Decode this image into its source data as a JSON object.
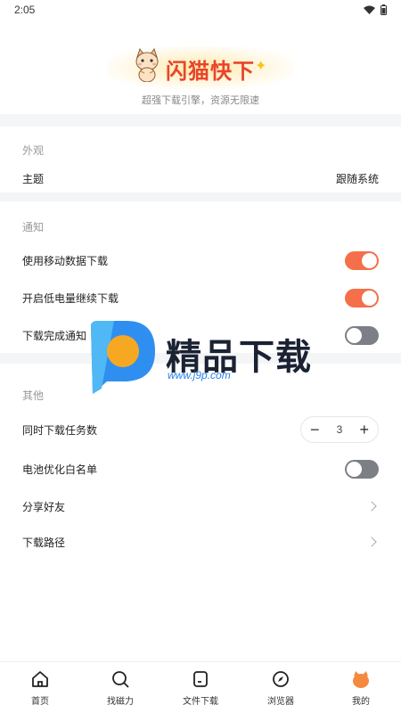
{
  "status_bar": {
    "time": "2:05",
    "icons": [
      "wifi-icon",
      "battery-icon"
    ]
  },
  "header": {
    "app_name": "闪猫快下",
    "tagline": "超强下载引擎，资源无限速"
  },
  "sections": {
    "appearance": {
      "title": "外观",
      "theme": {
        "label": "主题",
        "value": "跟随系统"
      }
    },
    "notifications": {
      "title": "通知",
      "mobile_data": {
        "label": "使用移动数据下载",
        "enabled": true
      },
      "low_battery": {
        "label": "开启低电量继续下载",
        "enabled": true
      },
      "complete_notify": {
        "label": "下载完成通知",
        "enabled": false
      }
    },
    "other": {
      "title": "其他",
      "concurrent": {
        "label": "同时下载任务数",
        "value": "3",
        "minus": "−",
        "plus": "+"
      },
      "battery_whitelist": {
        "label": "电池优化白名单",
        "enabled": false
      },
      "share": {
        "label": "分享好友"
      },
      "download_path": {
        "label": "下载路径"
      }
    }
  },
  "watermark": {
    "text": "精品下载",
    "url": "www.j9p.com"
  },
  "bottom_nav": {
    "items": [
      {
        "label": "首页",
        "icon": "home-icon"
      },
      {
        "label": "找磁力",
        "icon": "magnet-search-icon"
      },
      {
        "label": "文件下载",
        "icon": "file-icon"
      },
      {
        "label": "浏览器",
        "icon": "compass-icon"
      },
      {
        "label": "我的",
        "icon": "cat-profile-icon"
      }
    ]
  },
  "colors": {
    "accent": "#f46f4a",
    "toggle_off": "#7c7f86",
    "title_red": "#e8452c",
    "background": "#f4f5f7"
  }
}
